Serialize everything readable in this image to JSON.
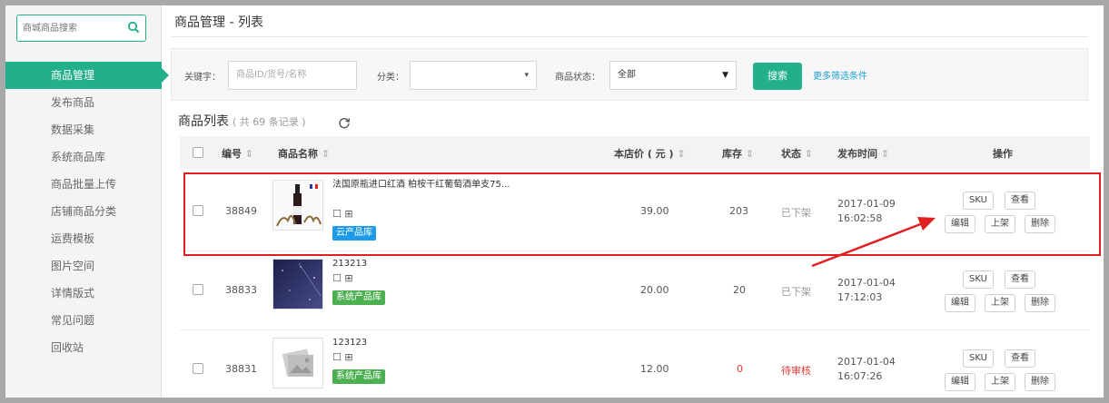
{
  "sidebar": {
    "search_placeholder": "商城商品搜索",
    "items": [
      {
        "label": "商品管理",
        "active": true
      },
      {
        "label": "发布商品"
      },
      {
        "label": "数据采集"
      },
      {
        "label": "系统商品库"
      },
      {
        "label": "商品批量上传"
      },
      {
        "label": "店铺商品分类"
      },
      {
        "label": "运费模板"
      },
      {
        "label": "图片空间"
      },
      {
        "label": "详情版式"
      },
      {
        "label": "常见问题"
      },
      {
        "label": "回收站"
      }
    ]
  },
  "page": {
    "title": "商品管理 - 列表"
  },
  "filter": {
    "keyword_label": "关键字：",
    "keyword_placeholder": "商品ID/货号/名称",
    "category_label": "分类：",
    "category_value": "",
    "status_label": "商品状态：",
    "status_value": "全部",
    "search_button": "搜索",
    "more_link": "更多筛选条件"
  },
  "list": {
    "title": "商品列表",
    "count_text": "( 共 69 条记录 )"
  },
  "table": {
    "headers": {
      "id": "编号",
      "name": "商品名称",
      "price": "本店价 ( 元 )",
      "stock": "库存",
      "status": "状态",
      "publish_time": "发布时间",
      "actions": "操作"
    },
    "sort_icon": "⇕",
    "rows": [
      {
        "id": "38849",
        "name": "法国原瓶进口红酒 柏桉干红葡萄酒单支75...",
        "tag": "云产品库",
        "tag_color": "#1e9be8",
        "price": "39.00",
        "stock": "203",
        "status": "已下架",
        "date": "2017-01-09",
        "time": "16:02:58",
        "actions": [
          "SKU",
          "查看",
          "编辑",
          "上架",
          "删除"
        ]
      },
      {
        "id": "38833",
        "name": "213213",
        "tag": "系统产品库",
        "tag_color": "#4caf50",
        "price": "20.00",
        "stock": "20",
        "status": "已下架",
        "date": "2017-01-04",
        "time": "17:12:03",
        "actions": [
          "SKU",
          "查看",
          "编辑",
          "上架",
          "删除"
        ]
      },
      {
        "id": "38831",
        "name": "123123",
        "tag": "系统产品库",
        "tag_color": "#4caf50",
        "price": "12.00",
        "stock": "0",
        "status": "待审核",
        "date": "2017-01-04",
        "time": "16:07:26",
        "actions": [
          "SKU",
          "查看",
          "编辑",
          "上架",
          "删除"
        ]
      }
    ]
  },
  "colors": {
    "accent": "#21b089",
    "annotation": "#e02020",
    "link": "#21a0d8"
  }
}
